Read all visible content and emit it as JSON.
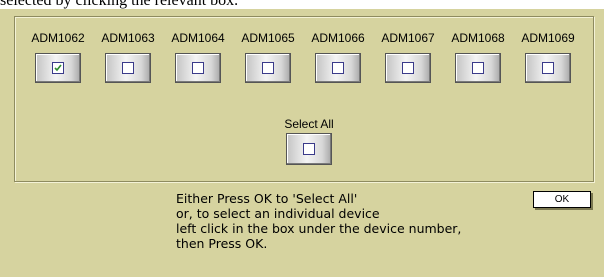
{
  "header_text": "selected by clicking the relevant box.",
  "devices": [
    {
      "label": "ADM1062",
      "checked": true
    },
    {
      "label": "ADM1063",
      "checked": false
    },
    {
      "label": "ADM1064",
      "checked": false
    },
    {
      "label": "ADM1065",
      "checked": false
    },
    {
      "label": "ADM1066",
      "checked": false
    },
    {
      "label": "ADM1067",
      "checked": false
    },
    {
      "label": "ADM1068",
      "checked": false
    },
    {
      "label": "ADM1069",
      "checked": false
    }
  ],
  "select_all": {
    "label": "Select All",
    "checked": false
  },
  "instructions": {
    "line1": "Either Press OK to 'Select All'",
    "line2": "or, to select an individual device",
    "line3": "left click in the box under the device number,",
    "line4": "then Press OK."
  },
  "ok_label": "OK",
  "colors": {
    "dialog_bg": "#d6d39f",
    "check_mark": "#2e8b2e"
  }
}
